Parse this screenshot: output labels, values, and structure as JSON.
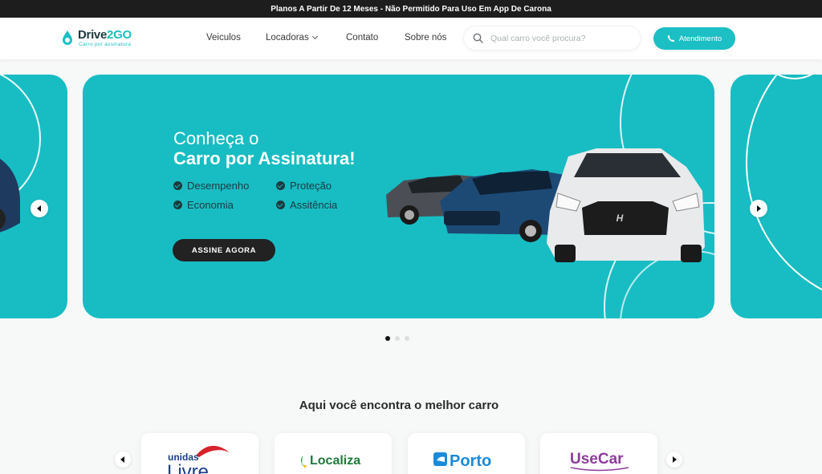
{
  "topbar": {
    "text": "Planos A Partir De 12 Meses - Não Permitido Para Uso Em App De Carona"
  },
  "header": {
    "logo": {
      "name_main": "Drive",
      "name_accent": "2GO",
      "tagline": "Carro por assinatura"
    },
    "nav": [
      {
        "label": "Veiculos"
      },
      {
        "label": "Locadoras"
      },
      {
        "label": "Contato"
      },
      {
        "label": "Sobre nós"
      }
    ],
    "search": {
      "placeholder": "Qual carro você procura?"
    },
    "cta": {
      "label": "Atendimento"
    }
  },
  "hero": {
    "line1": "Conheça o",
    "line2": "Carro por Assinatura!",
    "features": [
      "Desempenho",
      "Proteção",
      "Economia",
      "Assitência"
    ],
    "button": "ASSINE AGORA",
    "car_brand": "H"
  },
  "carousel": {
    "dots": 3,
    "active": 0
  },
  "brands_section": {
    "title": "Aqui você encontra o melhor carro",
    "brands": [
      {
        "name": "unidas",
        "sub": "Livre",
        "color": "#1a3f8f",
        "accent": "#d6232a"
      },
      {
        "name": "Localiza",
        "color": "#1c7a3a"
      },
      {
        "name": "Porto",
        "color": "#1a8ad9"
      },
      {
        "name": "UseCar",
        "color": "#8e3c9c"
      }
    ]
  },
  "colors": {
    "accent": "#1bbfc4",
    "dark": "#1d1d1d",
    "hero_bg": "#17bdc3"
  }
}
